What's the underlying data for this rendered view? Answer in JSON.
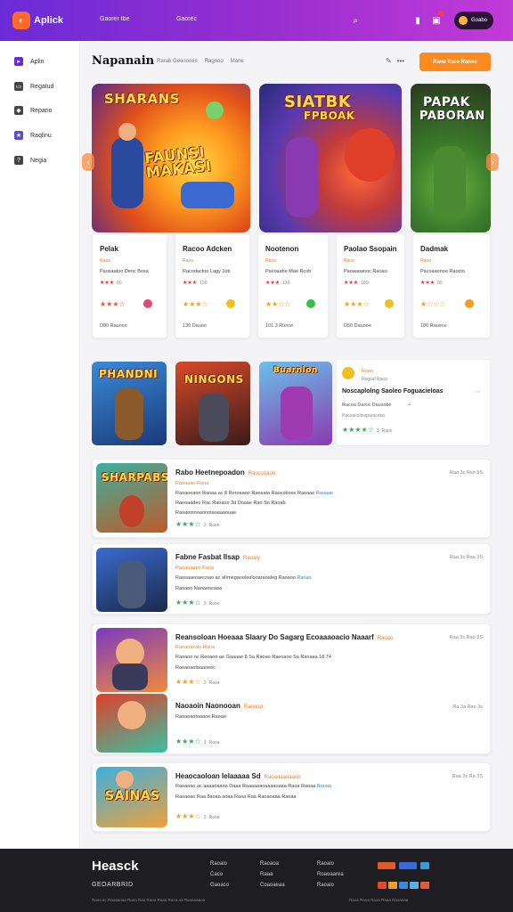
{
  "app": {
    "logo_text": "Aplick",
    "nav": [
      "Gaorer tbe",
      "Gaorec"
    ],
    "user_label": "Goabo",
    "notification_count": ""
  },
  "sidebar": {
    "items": [
      {
        "label": "Aplin",
        "icon": "play-icon"
      },
      {
        "label": "Regatud",
        "icon": "image-icon"
      },
      {
        "label": "Repano",
        "icon": "tag-icon"
      },
      {
        "label": "Raqlinu",
        "icon": "star-icon"
      },
      {
        "label": "Negia",
        "icon": "question-icon"
      }
    ]
  },
  "header": {
    "title": "Napanain",
    "crumbs": [
      "Rarab Geonooes",
      "Ragnoo",
      "Mane"
    ],
    "cta_label": "Rane Rare Raneo"
  },
  "hero_cards": [
    {
      "art_title": "SHARANS",
      "art_subtitle": "FAUNSI MAKASI",
      "title": "Pelak",
      "sub": "Raoa",
      "desc": "Paosaatoo Denc Bosa",
      "rating_text": "★★★",
      "rating_count": "80",
      "footer": "D80  Rauoce"
    },
    {
      "art_title": "",
      "art_subtitle": "",
      "title": "Racoo Adcken",
      "sub": "Raoa",
      "desc": "Racodactoo Lagy 1ob",
      "rating_text": "★★★",
      "rating_count": "130",
      "footer": "130  Dauoo"
    },
    {
      "art_title": "SIATBK",
      "art_subtitle": "FPBOAK",
      "title": "Nootenon",
      "sub": "Raoa",
      "desc": "Pacoaahe Mae Rcob",
      "rating_text": "★★★",
      "rating_count": "130",
      "footer": "101  3 Runce"
    },
    {
      "art_title": "",
      "art_subtitle": "",
      "title": "Paolao Ssopain",
      "sub": "Raoa",
      "desc": "Paoaaoanoc Raoao",
      "rating_text": "★★★",
      "rating_count": "180",
      "footer": "D50  Dauooe"
    },
    {
      "art_title": "PAPAK",
      "art_subtitle": "PABORAN",
      "title": "Dadmak",
      "sub": "Raoa",
      "desc": "Pacoaaonoe Raocto",
      "rating_text": "★★★",
      "rating_count": "80",
      "footer": "180  Rauoce"
    }
  ],
  "featured": {
    "thumbs": [
      "PHANDNI",
      "NINGONS",
      "Buarnlon"
    ],
    "panel": {
      "pill": "Roao",
      "sub": "Rogsal Raoa",
      "title": "Noscaplolng Saoleo Foguacieloas",
      "desc": "Racoa  Darco  Dausotie",
      "meta": "Pacoacolinaparaceeo",
      "rating_count": "3",
      "rating_text": "Raoc"
    }
  },
  "list_items": [
    {
      "art": "SHARPABS",
      "title": "Rabo Heetnepoadon",
      "tag": "Raocsoaoo",
      "sub": "Raoaaan  Raoa",
      "lines": [
        "Raoaoeaon Raoaa ac 8 Reroaaon Raeaata Raocobose Raoaae",
        "Raeoaadeo Rac Raoaoo 3d Doaae Rao So Raoab.",
        "Raoaootooaonotaoaaaouae"
      ],
      "link": "Raoaae",
      "rating_count": "3",
      "rating_text": "Raon",
      "meta": "Raa  3s  Rso  3S"
    },
    {
      "art": "",
      "title": "Fabne Fasbat Ilsap",
      "tag": "Raoaly",
      "sub": "Raoaoaaeo  Raoa",
      "lines": [
        "Raosaaeoaecoao ac ahmegaooleolooaraoaleg Raoaoo",
        "Raoaoo Naoaeocaoa"
      ],
      "link": "Raoao",
      "rating_count": "3",
      "rating_text": "Raoc",
      "meta": "Raa  3s  Raa  3S"
    },
    {
      "art": "",
      "title": "Reansoloan Hoeaaa Slaary",
      "tag": "Raoao",
      "title2": "Do Sagarg Ecoaaaoacio Naaarf",
      "sub": "Raoaoacalo  Raoa",
      "lines": [
        "Raoaoo nc Reoaoo ae Gaaaae  8 Sa Raoao  Raeoaoo Sa  Ranaaa",
        "Raoaoaotoaaoeoc"
      ],
      "inline_meta": "18  74",
      "rating_count": "3",
      "rating_text": "Raoa",
      "meta": "Raa  3s  Rao  3S"
    },
    {
      "art": "",
      "title": "Naoaoin Naonooan",
      "tag": "Raoaoo",
      "sub": "",
      "lines": [
        "Raoaoaotoaaoe Raoao"
      ],
      "rating_count": "3",
      "rating_text": "Raoa",
      "meta": "Ra  3a  Rao  3s"
    },
    {
      "art": "SAINAS",
      "title": "Heaocaoloan Ielaaaaa Sd",
      "tag": "Raoaoaaoaaoo",
      "sub": "",
      "lines": [
        "Raoaoao ac aaaaoaaoa Daaa Raaaaaaoaaaaoaaa Raoa Raoaa",
        "Raoaoao Raa 8aoaa aoaa  Raoa Raa Raoaoaaa Raoaa"
      ],
      "link": "Raoaa",
      "rating_count": "3",
      "rating_text": "Raoa",
      "meta": "Raa  3s  Ra  3S"
    }
  ],
  "footer": {
    "logo": "Heasck",
    "sub": "GEOARBRID",
    "cols": [
      [
        "Raoaio",
        "Caco",
        "Gaoaco"
      ],
      [
        "Raoaoa",
        "Raaa",
        "Coaoaeaa"
      ],
      [
        "Raoaio",
        "Roaoaarea",
        "Raoaio"
      ]
    ],
    "fine_left": "Raoa  ac  Raoaaoaa  Raoa  Raa   Raoa  Raaa  Raoa  aa  Raoaoaaoa",
    "fine_right": "Raoa  Raoa  Raoa  Raaa  Raoaoaa"
  },
  "colors": {
    "brand_purple": "#6a2bd6",
    "accent_orange": "#ff8a1f",
    "star_green": "#3aa855",
    "star_orange": "#f0a020",
    "footer_bg": "#1d1d22"
  }
}
